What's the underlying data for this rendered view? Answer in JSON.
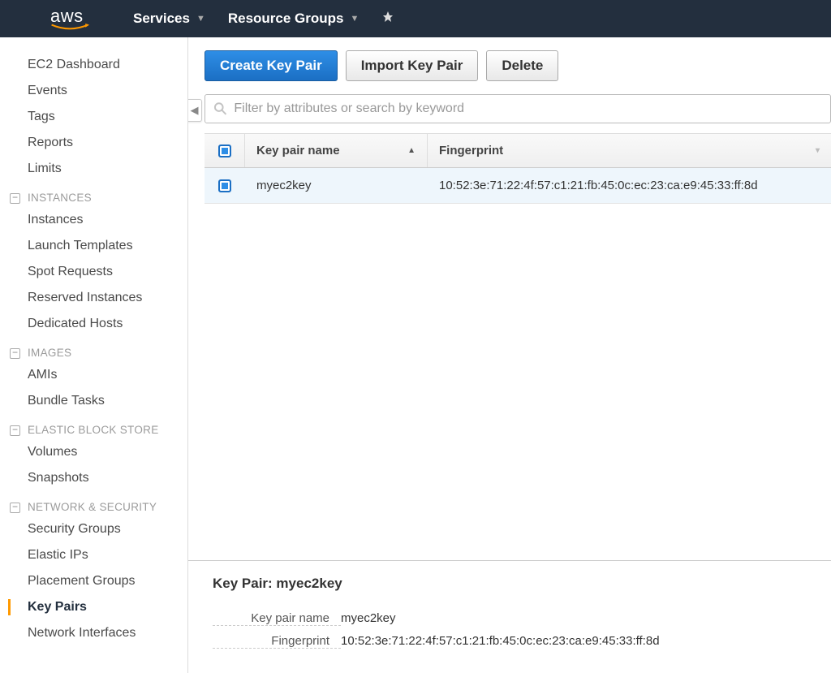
{
  "topnav": {
    "logo": "aws",
    "items": [
      "Services",
      "Resource Groups"
    ]
  },
  "sidebar": [
    {
      "type": "link",
      "label": "EC2 Dashboard"
    },
    {
      "type": "link",
      "label": "Events"
    },
    {
      "type": "link",
      "label": "Tags"
    },
    {
      "type": "link",
      "label": "Reports"
    },
    {
      "type": "link",
      "label": "Limits"
    },
    {
      "type": "section",
      "label": "INSTANCES"
    },
    {
      "type": "link",
      "label": "Instances"
    },
    {
      "type": "link",
      "label": "Launch Templates"
    },
    {
      "type": "link",
      "label": "Spot Requests"
    },
    {
      "type": "link",
      "label": "Reserved Instances"
    },
    {
      "type": "link",
      "label": "Dedicated Hosts"
    },
    {
      "type": "section",
      "label": "IMAGES"
    },
    {
      "type": "link",
      "label": "AMIs"
    },
    {
      "type": "link",
      "label": "Bundle Tasks"
    },
    {
      "type": "section",
      "label": "ELASTIC BLOCK STORE"
    },
    {
      "type": "link",
      "label": "Volumes"
    },
    {
      "type": "link",
      "label": "Snapshots"
    },
    {
      "type": "section",
      "label": "NETWORK & SECURITY"
    },
    {
      "type": "link",
      "label": "Security Groups"
    },
    {
      "type": "link",
      "label": "Elastic IPs"
    },
    {
      "type": "link",
      "label": "Placement Groups"
    },
    {
      "type": "link",
      "label": "Key Pairs",
      "active": true
    },
    {
      "type": "link",
      "label": "Network Interfaces"
    }
  ],
  "actions": {
    "create": "Create Key Pair",
    "import": "Import Key Pair",
    "delete": "Delete"
  },
  "search": {
    "placeholder": "Filter by attributes or search by keyword"
  },
  "table": {
    "columns": {
      "name": "Key pair name",
      "fingerprint": "Fingerprint"
    },
    "rows": [
      {
        "name": "myec2key",
        "fingerprint": "10:52:3e:71:22:4f:57:c1:21:fb:45:0c:ec:23:ca:e9:45:33:ff:8d",
        "selected": true
      }
    ]
  },
  "detail": {
    "heading": "Key Pair: myec2key",
    "fields": {
      "name_label": "Key pair name",
      "name_value": "myec2key",
      "fp_label": "Fingerprint",
      "fp_value": "10:52:3e:71:22:4f:57:c1:21:fb:45:0c:ec:23:ca:e9:45:33:ff:8d"
    }
  }
}
